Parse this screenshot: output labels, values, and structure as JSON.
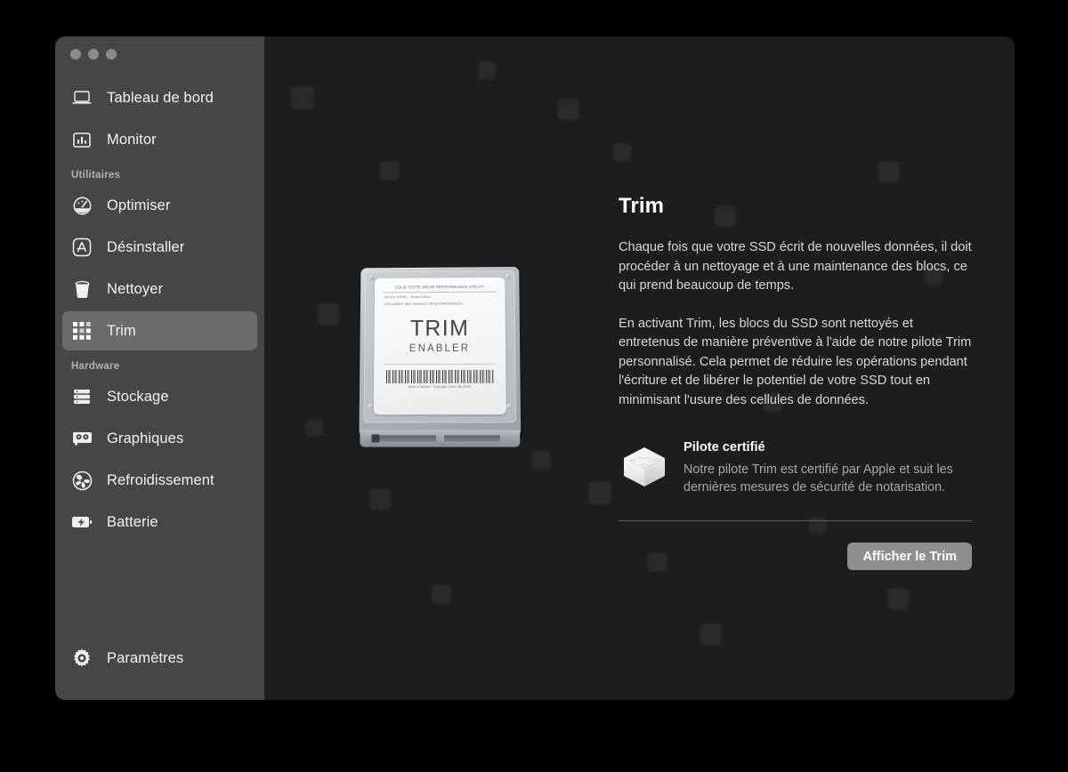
{
  "window": {
    "traffic_lights": [
      "close",
      "minimize",
      "zoom"
    ]
  },
  "sidebar": {
    "top_items": [
      {
        "label": "Tableau de bord",
        "icon": "laptop-icon",
        "selected": false
      },
      {
        "label": "Monitor",
        "icon": "bar-chart-icon",
        "selected": false
      }
    ],
    "sections": [
      {
        "title": "Utilitaires",
        "items": [
          {
            "label": "Optimiser",
            "icon": "gauge-icon",
            "selected": false
          },
          {
            "label": "Désinstaller",
            "icon": "app-store-icon",
            "selected": false
          },
          {
            "label": "Nettoyer",
            "icon": "trash-icon",
            "selected": false
          },
          {
            "label": "Trim",
            "icon": "grid-icon",
            "selected": true
          }
        ]
      },
      {
        "title": "Hardware",
        "items": [
          {
            "label": "Stockage",
            "icon": "server-icon",
            "selected": false
          },
          {
            "label": "Graphiques",
            "icon": "gpu-icon",
            "selected": false
          },
          {
            "label": "Refroidissement",
            "icon": "fan-icon",
            "selected": false
          },
          {
            "label": "Batterie",
            "icon": "battery-bolt-icon",
            "selected": false
          }
        ]
      }
    ],
    "bottom_item": {
      "label": "Paramètres",
      "icon": "gear-icon"
    }
  },
  "artwork": {
    "label_header": "SOLID STATE DRIVE PERFORMANCE UTILITY",
    "label_line1": "DEVICE MODEL : Sensei Edition",
    "label_line2": "DISCLAIMER: MAY ENHANCE DRIVE PERFORMANCE",
    "brand_glyph": "",
    "title": "TRIM",
    "subtitle": "ENABLER",
    "fine_print": "Made in Sweden · Copyright Cindori AB (2020)"
  },
  "main": {
    "title": "Trim",
    "paragraph1": "Chaque fois que votre SSD écrit de nouvelles données, il doit procéder à un nettoyage et à une maintenance des blocs, ce qui prend beaucoup de temps.",
    "paragraph2": "En activant Trim, les blocs du SSD sont nettoyés et entretenus de manière préventive à l'aide de notre pilote Trim personnalisé. Cela permet de réduire les opérations pendant l'écriture et de libérer le potentiel de votre SSD tout en minimisant l'usure des cellules de données.",
    "driver": {
      "icon": "kernel-extension-cube-icon",
      "title": "Pilote certifié",
      "description": "Notre pilote Trim est certifié par Apple et suit les dernières mesures de sécurité de notarisation."
    },
    "action_button": "Afficher le Trim"
  },
  "colors": {
    "sidebar_bg": "#464646",
    "main_bg": "#1d1d1d",
    "selected_item": "#6b6b6b",
    "button_bg": "#8e8e8e",
    "primary_text": "#ffffff",
    "secondary_text": "#a7a7a7"
  }
}
